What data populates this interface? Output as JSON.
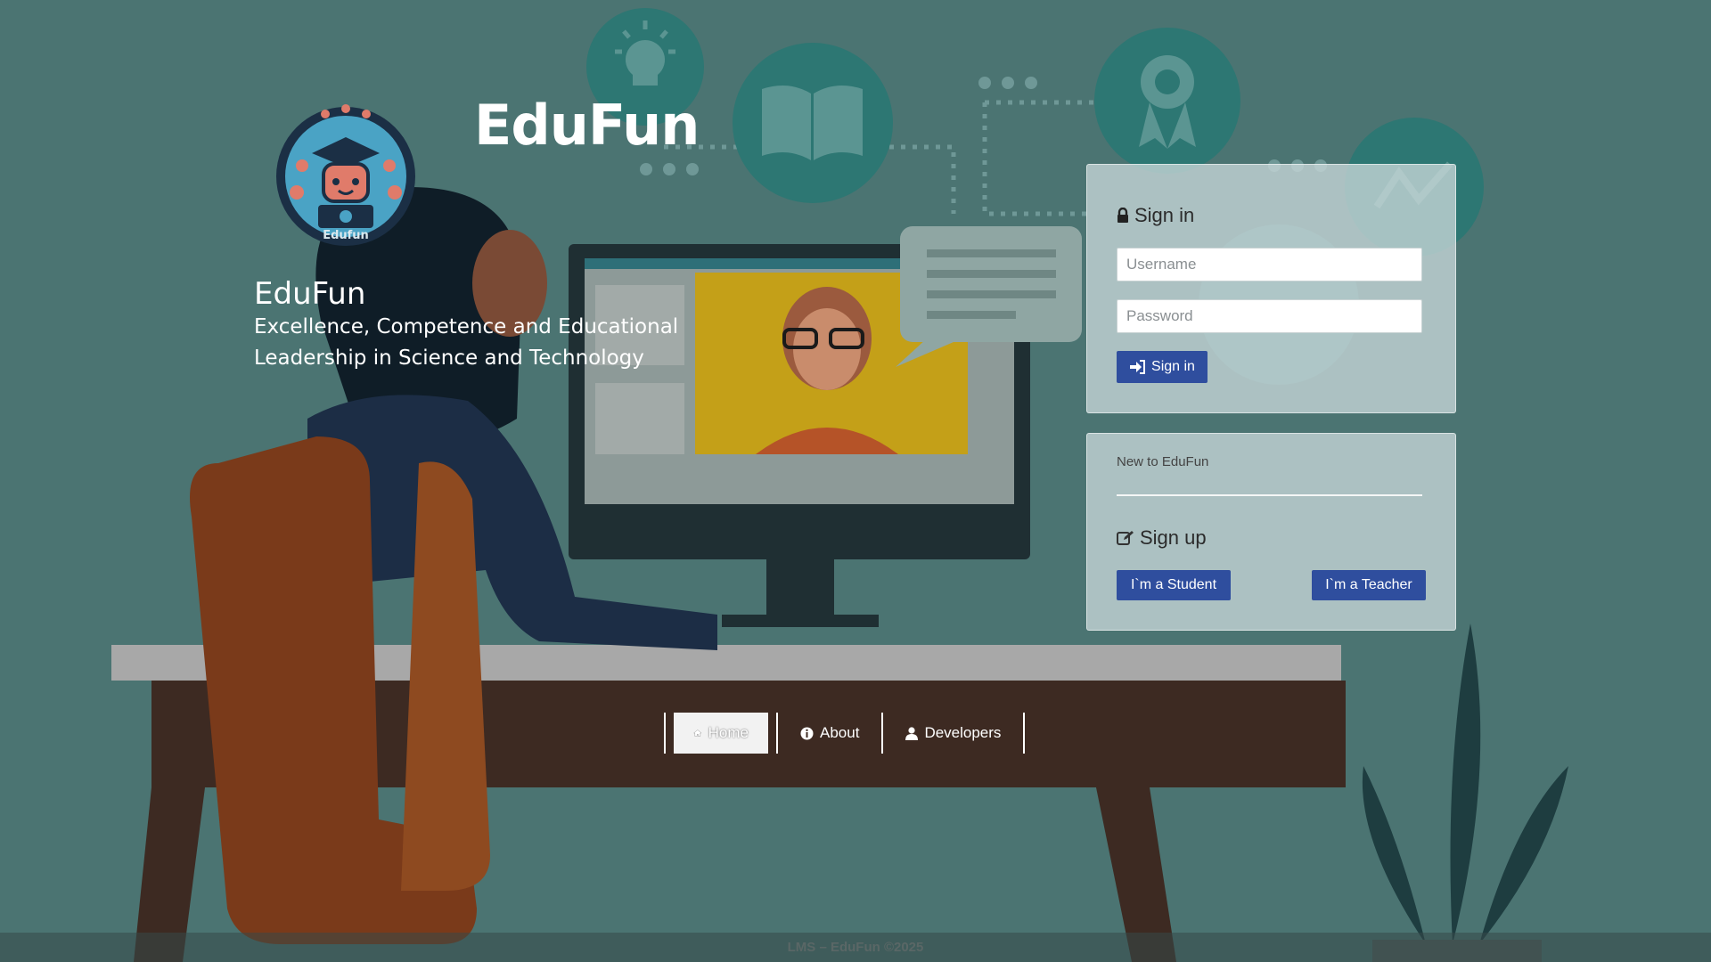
{
  "brand": {
    "name": "EduFun",
    "logo_text": "Edufun"
  },
  "hero": {
    "title": "EduFun",
    "tagline_line1": "Excellence, Competence and Educational",
    "tagline_line2": "Leadership in Science and Technology"
  },
  "signin": {
    "heading": "Sign in",
    "username_placeholder": "Username",
    "password_placeholder": "Password",
    "button_label": "Sign in"
  },
  "signup": {
    "new_label": "New to EduFun",
    "heading": "Sign up",
    "student_button": "I`m a Student",
    "teacher_button": "I`m a Teacher"
  },
  "nav": {
    "items": [
      {
        "label": "Home",
        "icon": "home-icon",
        "active": true
      },
      {
        "label": "About",
        "icon": "info-icon",
        "active": false
      },
      {
        "label": "Developers",
        "icon": "user-icon",
        "active": false
      }
    ]
  },
  "footer": {
    "text": "LMS – EduFun ©2025"
  },
  "colors": {
    "primary_button": "#2f4e9e",
    "background": "#4b7472"
  }
}
